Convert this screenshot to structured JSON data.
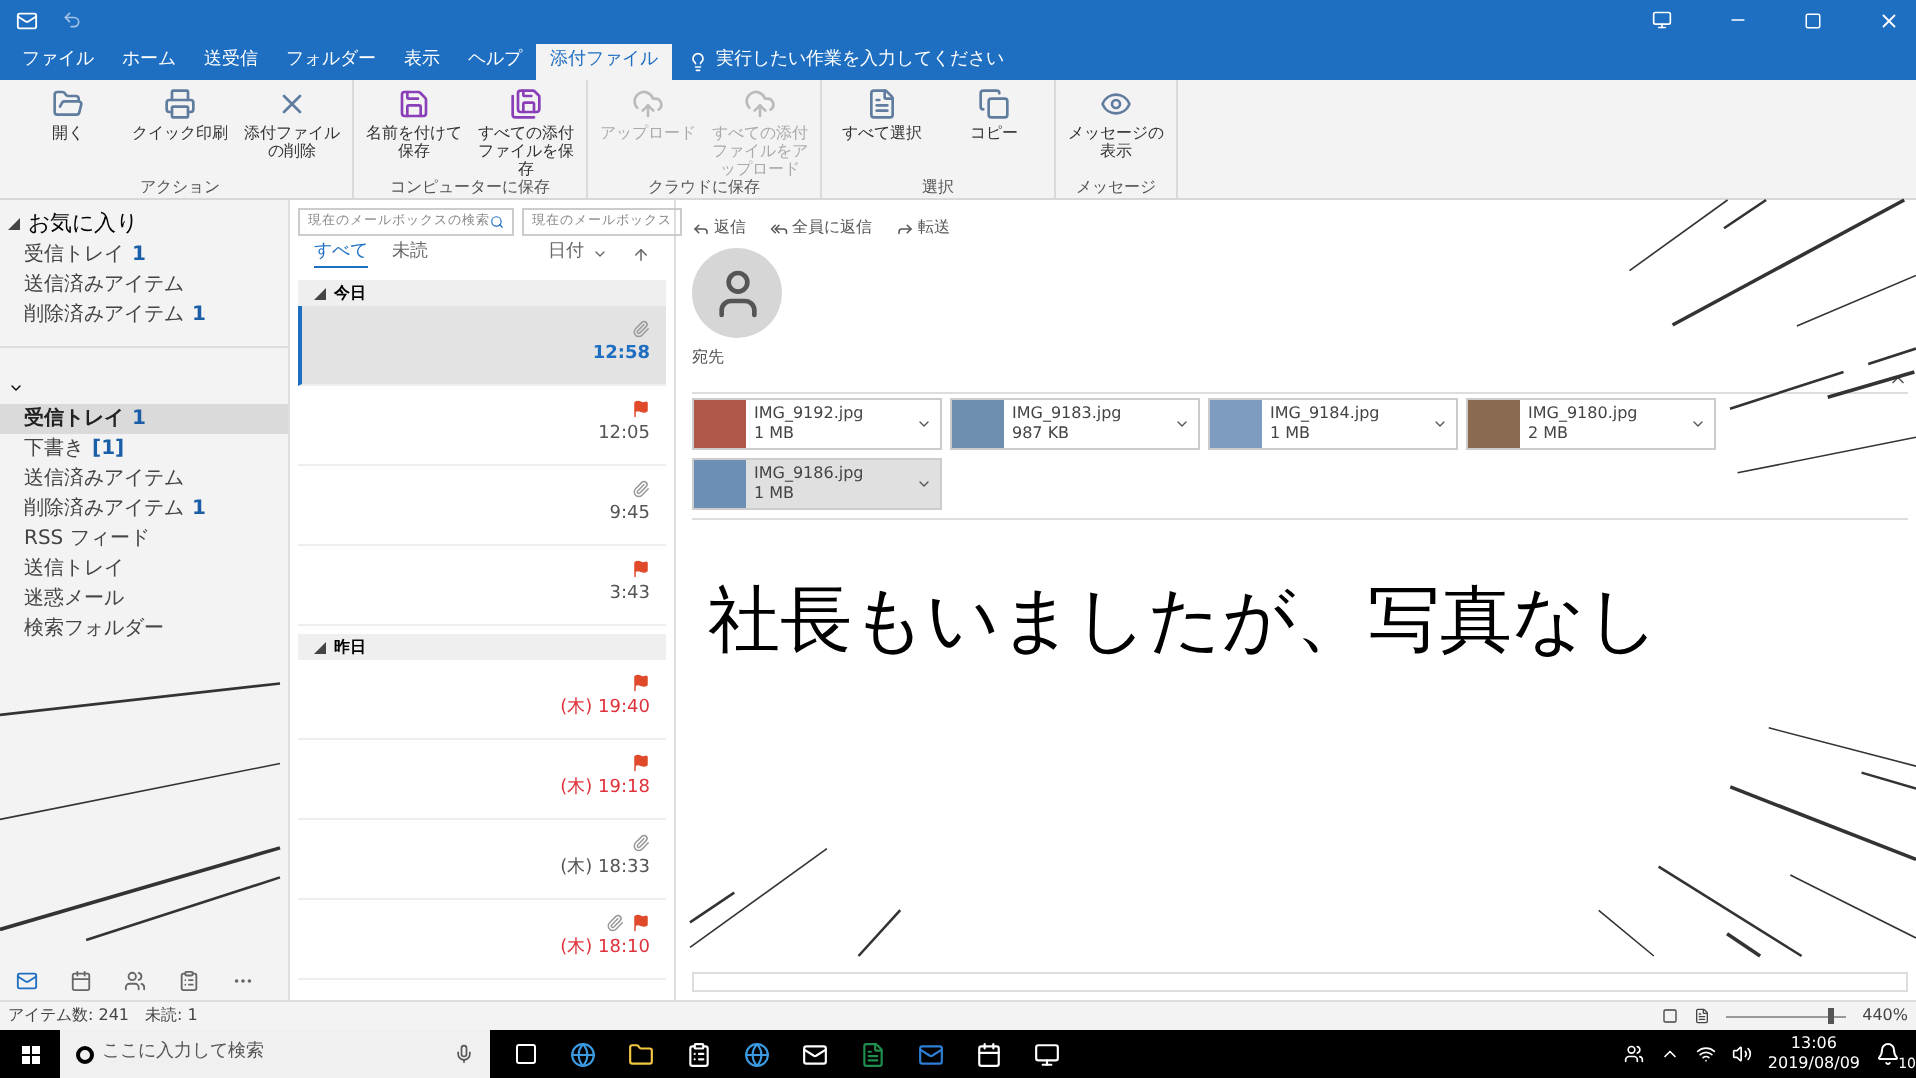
{
  "window": {
    "tabs": [
      {
        "label": "ファイル",
        "selected": false
      },
      {
        "label": "ホーム",
        "selected": false
      },
      {
        "label": "送受信",
        "selected": false
      },
      {
        "label": "フォルダー",
        "selected": false
      },
      {
        "label": "表示",
        "selected": false
      },
      {
        "label": "ヘルプ",
        "selected": false
      },
      {
        "label": "添付ファイル",
        "selected": true
      }
    ],
    "tell_me": "実行したい作業を入力してください"
  },
  "ribbon": {
    "groups": [
      {
        "label": "アクション",
        "buttons": [
          {
            "kind": "open",
            "label": "開く",
            "disabled": false
          },
          {
            "kind": "print",
            "label": "クイック印刷",
            "disabled": false
          },
          {
            "kind": "delete",
            "label": "添付ファイルの削除",
            "disabled": false
          }
        ]
      },
      {
        "label": "コンピューターに保存",
        "buttons": [
          {
            "kind": "save",
            "label": "名前を付けて保存",
            "disabled": false
          },
          {
            "kind": "saveall",
            "label": "すべての添付ファイルを保存",
            "disabled": false
          }
        ]
      },
      {
        "label": "クラウドに保存",
        "buttons": [
          {
            "kind": "upload",
            "label": "アップロード",
            "disabled": true
          },
          {
            "kind": "upload",
            "label": "すべての添付ファイルをアップロード",
            "disabled": true
          }
        ]
      },
      {
        "label": "選択",
        "buttons": [
          {
            "kind": "selectall",
            "label": "すべて選択",
            "disabled": false
          },
          {
            "kind": "copy",
            "label": "コピー",
            "disabled": false
          }
        ]
      },
      {
        "label": "メッセージ",
        "buttons": [
          {
            "kind": "message",
            "label": "メッセージの表示",
            "disabled": false
          }
        ]
      }
    ]
  },
  "folders": {
    "favorites_title": "お気に入り",
    "favorites": [
      {
        "name": "受信トレイ",
        "count": "1",
        "selected": false
      },
      {
        "name": "送信済みアイテム",
        "selected": false
      },
      {
        "name": "削除済みアイテム",
        "count": "1",
        "selected": false
      }
    ],
    "account": [
      {
        "name": "受信トレイ",
        "count": "1",
        "selected": true
      },
      {
        "name": "下書き",
        "count": "[1]",
        "selected": false
      },
      {
        "name": "送信済みアイテム",
        "selected": false
      },
      {
        "name": "削除済みアイテム",
        "count": "1",
        "selected": false
      },
      {
        "name": "RSS フィード",
        "selected": false
      },
      {
        "name": "送信トレイ",
        "selected": false
      },
      {
        "name": "迷惑メール",
        "selected": false
      },
      {
        "name": "検索フォルダー",
        "selected": false
      }
    ]
  },
  "message_list": {
    "search_placeholder": "現在のメールボックスの検索",
    "scope": "現在のメールボックス",
    "filters": [
      {
        "label": "すべて",
        "selected": true
      },
      {
        "label": "未読",
        "selected": false
      }
    ],
    "sort": "日付",
    "groups": [
      {
        "title": "今日",
        "messages": [
          {
            "time": "12:58",
            "attachment": true,
            "flag": false,
            "selected": true,
            "overdue": false
          },
          {
            "time": "12:05",
            "attachment": false,
            "flag": true,
            "selected": false,
            "overdue": false
          },
          {
            "time": "9:45",
            "attachment": true,
            "flag": false,
            "selected": false,
            "overdue": false
          },
          {
            "time": "3:43",
            "attachment": false,
            "flag": true,
            "selected": false,
            "overdue": false
          }
        ]
      },
      {
        "title": "昨日",
        "messages": [
          {
            "time": "(木) 19:40",
            "attachment": false,
            "flag": true,
            "selected": false,
            "overdue": true
          },
          {
            "time": "(木) 19:18",
            "attachment": false,
            "flag": true,
            "selected": false,
            "overdue": true
          },
          {
            "time": "(木) 18:33",
            "attachment": true,
            "flag": false,
            "selected": false,
            "overdue": false
          },
          {
            "time": "(木) 18:10",
            "attachment": true,
            "flag": true,
            "selected": false,
            "overdue": true
          }
        ]
      }
    ]
  },
  "reading": {
    "actions": [
      "返信",
      "全員に返信",
      "転送"
    ],
    "to_label": "宛先",
    "attachments": [
      {
        "name": "IMG_9192.jpg",
        "size": "1 MB",
        "selected": false,
        "color": "#b0584a"
      },
      {
        "name": "IMG_9183.jpg",
        "size": "987 KB",
        "selected": false,
        "color": "#6f8fb0"
      },
      {
        "name": "IMG_9184.jpg",
        "size": "1 MB",
        "selected": false,
        "color": "#7d9cc0"
      },
      {
        "name": "IMG_9180.jpg",
        "size": "2 MB",
        "selected": false,
        "color": "#8a6a50"
      },
      {
        "name": "IMG_9186.jpg",
        "size": "1 MB",
        "selected": true,
        "color": "#6d8fb5"
      }
    ],
    "body": "社長もいましたが、写真なし",
    "zoom": "440%",
    "zoom_slider": {
      "level": 0.9
    }
  },
  "status_bar": {
    "items": "アイテム数: 241",
    "unread": "未読: 1"
  },
  "taskbar": {
    "search_placeholder": "ここに入力して検索",
    "time": "13:06",
    "date": "2019/08/09",
    "notifications": "10"
  }
}
